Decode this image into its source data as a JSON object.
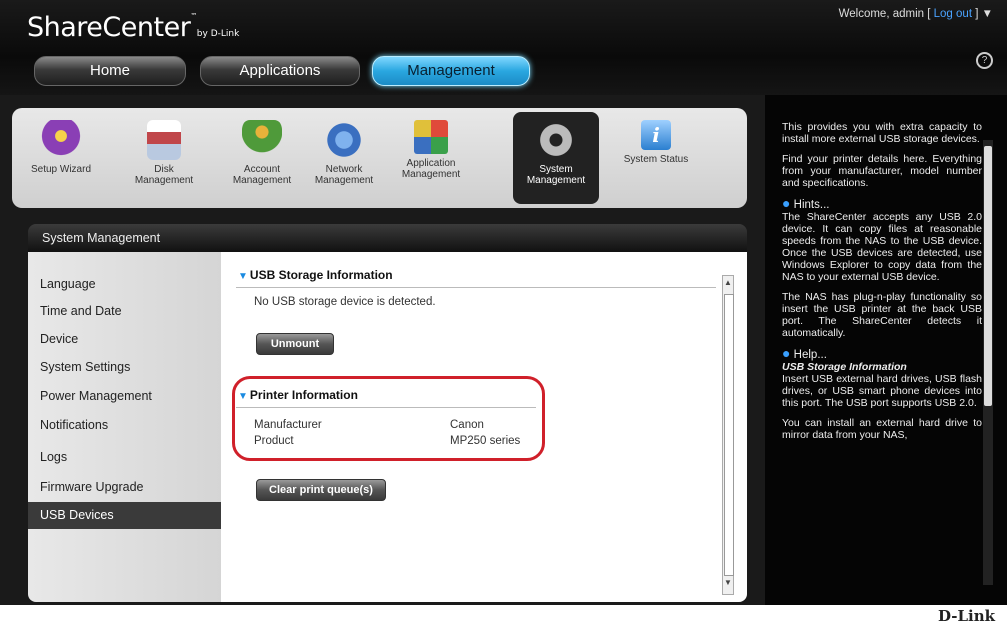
{
  "header": {
    "logo_main": "ShareCenter",
    "logo_by": "by D-Link",
    "welcome_text": "Welcome, admin [",
    "logout_label": "Log out",
    "welcome_close": "] ▼",
    "help_icon": "?",
    "tabs": [
      {
        "label": "Home",
        "active": false
      },
      {
        "label": "Applications",
        "active": false
      },
      {
        "label": "Management",
        "active": true
      }
    ]
  },
  "iconbar": {
    "items": [
      {
        "label1": "Setup Wizard",
        "label2": "",
        "icon": "wizard-icon",
        "color": "#8a3fb5"
      },
      {
        "label1": "Disk",
        "label2": "Management",
        "icon": "disk-icon",
        "color": "#c0464a"
      },
      {
        "label1": "Account",
        "label2": "Management",
        "icon": "account-icon",
        "color": "#4f9a3a"
      },
      {
        "label1": "Network",
        "label2": "Management",
        "icon": "network-icon",
        "color": "#3a6fc0"
      },
      {
        "label1": "Application",
        "label2": "Management",
        "icon": "application-icon",
        "color": "#d9a03a"
      },
      {
        "label1": "System",
        "label2": "Management",
        "icon": "system-icon",
        "color": "#555555",
        "selected": true
      },
      {
        "label1": "System Status",
        "label2": "",
        "icon": "info-icon",
        "color": "#2b7fd0"
      }
    ]
  },
  "panel_title": "System Management",
  "menu": {
    "items": [
      {
        "label": "Language"
      },
      {
        "label": "Time and Date"
      },
      {
        "label": "Device"
      },
      {
        "label": "System Settings"
      },
      {
        "label": "Power Management"
      },
      {
        "label": "Notifications"
      },
      {
        "label": "Logs"
      },
      {
        "label": "Firmware Upgrade"
      },
      {
        "label": "USB Devices",
        "selected": true
      }
    ]
  },
  "usb": {
    "heading": "USB Storage Information",
    "status": "No USB storage device is detected.",
    "unmount_label": "Unmount"
  },
  "printer": {
    "heading": "Printer Information",
    "manufacturer_label": "Manufacturer",
    "manufacturer_value": "Canon",
    "product_label": "Product",
    "product_value": "MP250 series",
    "clear_label": "Clear print queue(s)"
  },
  "help": {
    "p1": "This provides you with extra capacity to install more external USB storage devices.",
    "p2": "Find your printer details here. Everything from your manufacturer, model number and specifications.",
    "hints_title": "Hints...",
    "p3": "The ShareCenter accepts any USB 2.0 device. It can copy files at reasonable speeds from the NAS to the USB device. Once the USB devices are detected, use Windows Explorer to copy data from the NAS to your external USB device.",
    "p4": "The NAS has plug-n-play functionality so insert the USB printer at the back USB port. The ShareCenter detects it automatically.",
    "help_title": "Help...",
    "usb_info_title": "USB Storage Information",
    "p5": "Insert USB external hard drives, USB flash drives, or USB smart phone devices into this port. The USB port supports USB 2.0.",
    "p6": "You can install an external hard drive to mirror data from your NAS,"
  },
  "footer_brand": "D-Link"
}
